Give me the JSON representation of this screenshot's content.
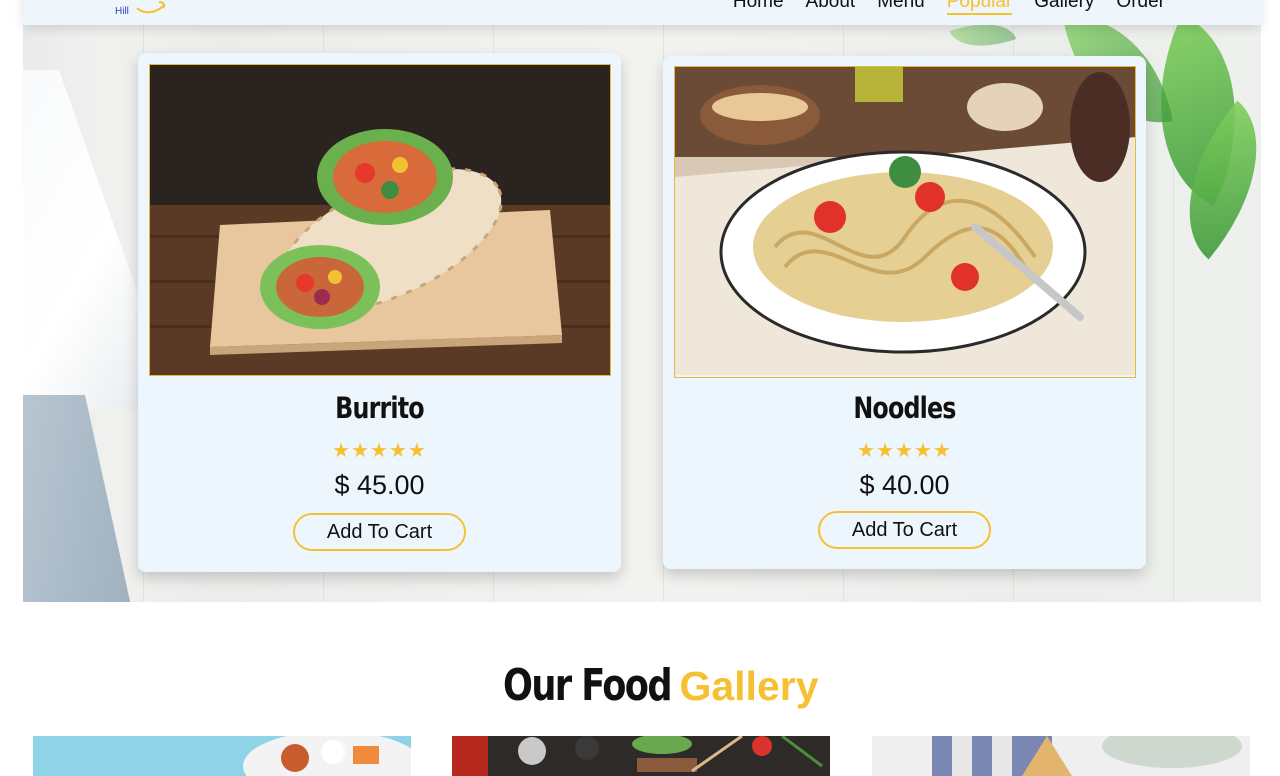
{
  "brand": {
    "text": "Hill"
  },
  "nav": {
    "items": [
      "Home",
      "About",
      "Menu",
      "Popular",
      "Gallery",
      "Order"
    ],
    "active": "Popular"
  },
  "popular": {
    "cards": [
      {
        "title": "Burrito",
        "stars": "★★★★★",
        "price": "$ 45.00",
        "button": "Add To Cart",
        "image_icon": "burrito-image"
      },
      {
        "title": "Noodles",
        "stars": "★★★★★",
        "price": "$ 40.00",
        "button": "Add To Cart",
        "image_icon": "noodles-image"
      }
    ]
  },
  "gallery": {
    "title_part1": "Our Food",
    "title_part2": "Gallery"
  },
  "colors": {
    "accent": "#f5c032",
    "card_bg": "#eef6fd",
    "nav_bg": "#eef5fb"
  }
}
